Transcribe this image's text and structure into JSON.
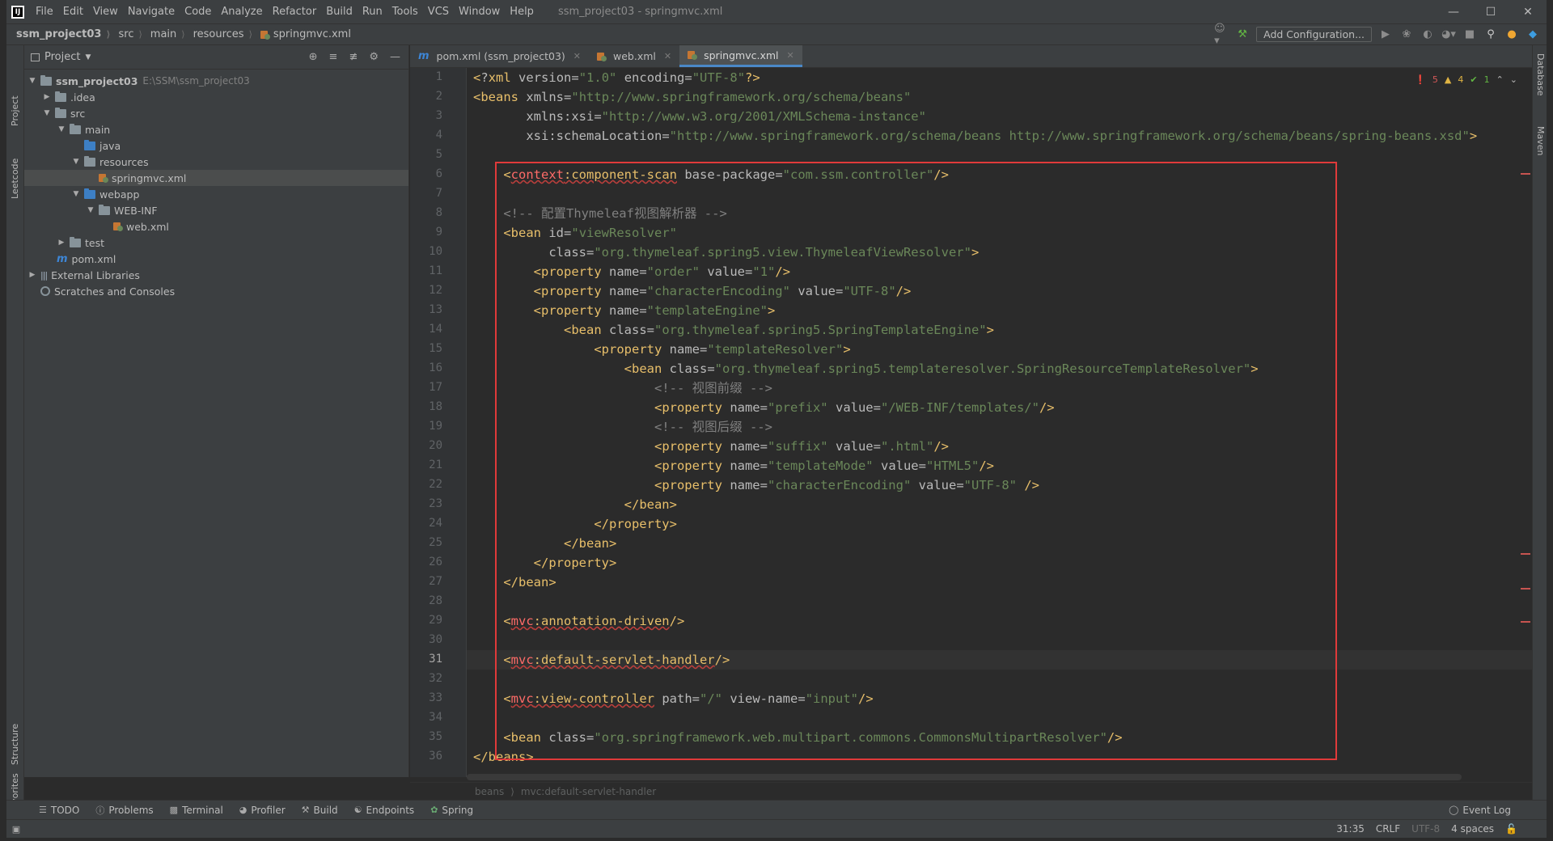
{
  "window": {
    "title": "ssm_project03 - springmvc.xml",
    "menu": [
      "File",
      "Edit",
      "View",
      "Navigate",
      "Code",
      "Analyze",
      "Refactor",
      "Build",
      "Run",
      "Tools",
      "VCS",
      "Window",
      "Help"
    ]
  },
  "navbar": {
    "crumbs": [
      "ssm_project03",
      "src",
      "main",
      "resources",
      "springmvc.xml"
    ],
    "add_config": "Add Configuration..."
  },
  "left_strip": {
    "tabs": [
      "Project",
      "Leetcode",
      "Structure",
      "Favorites"
    ]
  },
  "right_strip": {
    "tabs": [
      "Database",
      "Maven"
    ]
  },
  "project_panel": {
    "title": "Project",
    "tree": [
      {
        "label": "ssm_project03",
        "extra": "E:\\SSM\\ssm_project03"
      },
      {
        "label": ".idea"
      },
      {
        "label": "src"
      },
      {
        "label": "main"
      },
      {
        "label": "java"
      },
      {
        "label": "resources"
      },
      {
        "label": "springmvc.xml"
      },
      {
        "label": "webapp"
      },
      {
        "label": "WEB-INF"
      },
      {
        "label": "web.xml"
      },
      {
        "label": "test"
      },
      {
        "label": "pom.xml"
      },
      {
        "label": "External Libraries"
      },
      {
        "label": "Scratches and Consoles"
      }
    ]
  },
  "editor_tabs": [
    {
      "label": "pom.xml (ssm_project03)"
    },
    {
      "label": "web.xml"
    },
    {
      "label": "springmvc.xml"
    }
  ],
  "inspection": {
    "errors": "5",
    "warnings": "4",
    "ok": "1"
  },
  "code_lines": [
    "<?xml version=\"1.0\" encoding=\"UTF-8\"?>",
    "<beans xmlns=\"http://www.springframework.org/schema/beans\"",
    "       xmlns:xsi=\"http://www.w3.org/2001/XMLSchema-instance\"",
    "       xsi:schemaLocation=\"http://www.springframework.org/schema/beans http://www.springframework.org/schema/beans/spring-beans.xsd\">",
    "",
    "    <context:component-scan base-package=\"com.ssm.controller\"/>",
    "",
    "    <!-- 配置Thymeleaf视图解析器 -->",
    "    <bean id=\"viewResolver\"",
    "          class=\"org.thymeleaf.spring5.view.ThymeleafViewResolver\">",
    "        <property name=\"order\" value=\"1\"/>",
    "        <property name=\"characterEncoding\" value=\"UTF-8\"/>",
    "        <property name=\"templateEngine\">",
    "            <bean class=\"org.thymeleaf.spring5.SpringTemplateEngine\">",
    "                <property name=\"templateResolver\">",
    "                    <bean class=\"org.thymeleaf.spring5.templateresolver.SpringResourceTemplateResolver\">",
    "                        <!-- 视图前缀 -->",
    "                        <property name=\"prefix\" value=\"/WEB-INF/templates/\"/>",
    "                        <!-- 视图后缀 -->",
    "                        <property name=\"suffix\" value=\".html\"/>",
    "                        <property name=\"templateMode\" value=\"HTML5\"/>",
    "                        <property name=\"characterEncoding\" value=\"UTF-8\" />",
    "                    </bean>",
    "                </property>",
    "            </bean>",
    "        </property>",
    "    </bean>",
    "",
    "    <mvc:annotation-driven/>",
    "",
    "    <mvc:default-servlet-handler/>",
    "",
    "    <mvc:view-controller path=\"/\" view-name=\"input\"/>",
    "",
    "    <bean class=\"org.springframework.web.multipart.commons.CommonsMultipartResolver\"/>",
    "</beans>"
  ],
  "current_line": 31,
  "editor_breadcrumb": [
    "beans",
    "mvc:default-servlet-handler"
  ],
  "bottom_tools": [
    "TODO",
    "Problems",
    "Terminal",
    "Profiler",
    "Build",
    "Endpoints",
    "Spring"
  ],
  "event_log": "Event Log",
  "status": {
    "position": "31:35",
    "line_sep": "CRLF",
    "encoding": "UTF-8",
    "indent": "4 spaces"
  }
}
